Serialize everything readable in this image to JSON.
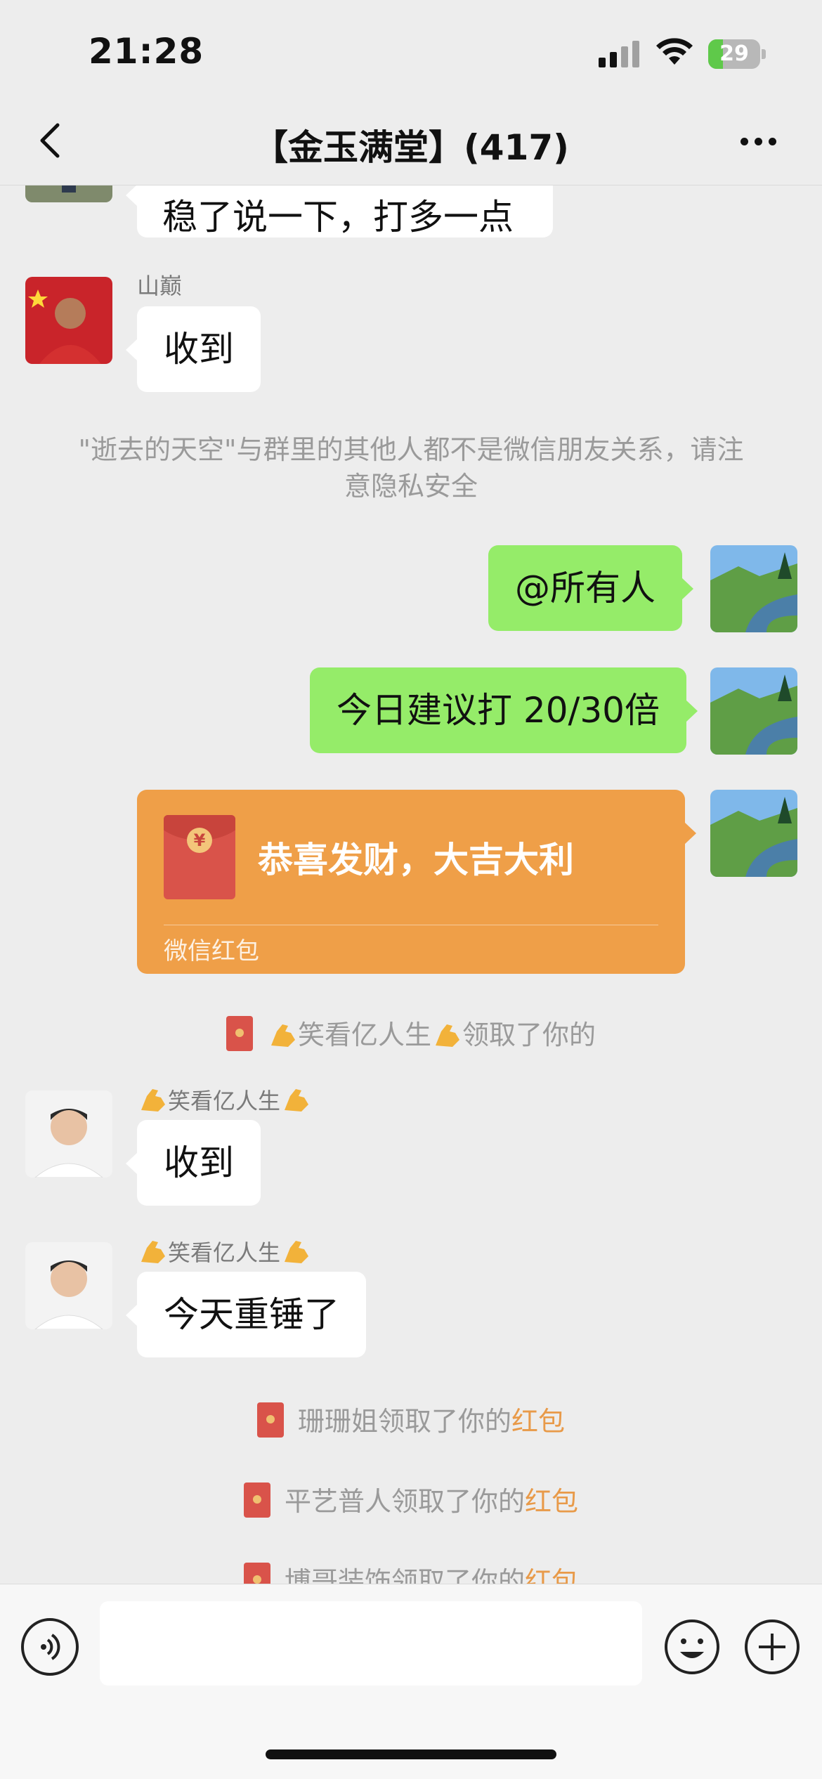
{
  "status_bar": {
    "time": "21:28",
    "battery": "29",
    "battery_level": 0.29
  },
  "header": {
    "title": "【金玉满堂】(417)"
  },
  "messages": [
    {
      "type": "in",
      "text": "稳了说一下，打多一点"
    },
    {
      "type": "in",
      "sender": "山巅",
      "text": "收到"
    },
    {
      "type": "system",
      "text": "\"逝去的天空\"与群里的其他人都不是微信朋友关系，请注意隐私安全"
    },
    {
      "type": "out",
      "text": "@所有人"
    },
    {
      "type": "out",
      "text": "今日建议打 20/30倍"
    },
    {
      "type": "red_packet",
      "title": "恭喜发财，大吉大利",
      "label": "微信红包"
    },
    {
      "type": "system",
      "name": "笑看亿人生",
      "suffix": "领取了你的"
    },
    {
      "type": "in",
      "sender": "笑看亿人生",
      "text": "收到"
    },
    {
      "type": "in",
      "sender": "笑看亿人生",
      "text": "今天重锤了"
    },
    {
      "type": "system",
      "name": "珊珊姐",
      "suffix": "领取了你的",
      "highlight": "红包"
    },
    {
      "type": "system",
      "name": "平艺普人",
      "suffix": "领取了你的",
      "highlight": "红包"
    },
    {
      "type": "system",
      "name": "博哥装饰",
      "suffix": "领取了你的",
      "highlight": "红包"
    }
  ],
  "input": {
    "value": "",
    "placeholder": ""
  },
  "colors": {
    "accent_out": "#95ec69",
    "red_packet": "#ef9f48",
    "highlight": "#e89a49"
  }
}
